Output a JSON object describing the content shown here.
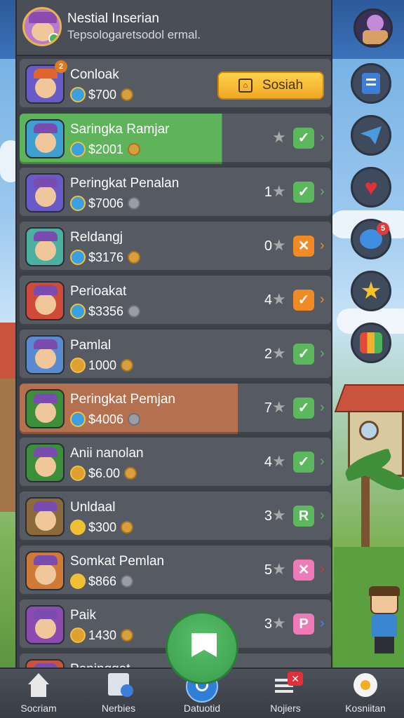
{
  "header": {
    "title": "Nestial Inserian",
    "subtitle": "Tepsologaretsodol ermal."
  },
  "featured": {
    "name": "Conloak",
    "value": "$700",
    "button_label": "Sosiah"
  },
  "rows": [
    {
      "name": "Saringka Ramjar",
      "value": "$2001",
      "rank": "",
      "action": "check",
      "badge": ""
    },
    {
      "name": "Peringkat Penalan",
      "value": "$7006",
      "rank": "1",
      "action": "check",
      "badge": ""
    },
    {
      "name": "Reldangj",
      "value": "$3176",
      "rank": "0",
      "action": "x",
      "badge": ""
    },
    {
      "name": "Perioakat",
      "value": "$3356",
      "rank": "4",
      "action": "check-orange",
      "badge": ""
    },
    {
      "name": "Pamlal",
      "value": "1000",
      "rank": "2",
      "action": "check",
      "badge": ""
    },
    {
      "name": "Peringkat Pemjan",
      "value": "$4006",
      "rank": "7",
      "action": "check",
      "badge": ""
    },
    {
      "name": "Anii nanolan",
      "value": "$6.00",
      "rank": "4",
      "action": "check",
      "badge": ""
    },
    {
      "name": "Unldaal",
      "value": "$300",
      "rank": "3",
      "action": "R",
      "badge": ""
    },
    {
      "name": "Somkat Pemlan",
      "value": "$866",
      "rank": "5",
      "action": "x-pink",
      "badge": ""
    },
    {
      "name": "Paik",
      "value": "1430",
      "rank": "3",
      "action": "P",
      "badge": ""
    },
    {
      "name": "Peninggat",
      "value": "",
      "rank": "",
      "action": "",
      "badge": ""
    }
  ],
  "badges": {
    "featured": "2",
    "row3": "5"
  },
  "side_buttons": [
    {
      "icon": "clipboard-icon"
    },
    {
      "icon": "paper-plane-icon"
    },
    {
      "icon": "heart-icon"
    },
    {
      "icon": "chat-bubble-icon",
      "count": "5"
    },
    {
      "icon": "star-icon"
    },
    {
      "icon": "gift-icon"
    }
  ],
  "nav": [
    {
      "label": "Socriam",
      "icon": "home-icon"
    },
    {
      "label": "Nerbies",
      "icon": "calendar-icon"
    },
    {
      "label": "Datuotid",
      "icon": "search-icon"
    },
    {
      "label": "Nojiers",
      "icon": "list-icon"
    },
    {
      "label": "Kosniitan",
      "icon": "flower-icon"
    }
  ],
  "colors": {
    "panel": "#3c4048",
    "row": "#555a63",
    "green_check": "#5cb85c",
    "orange": "#f08a24",
    "pink": "#f07ab8",
    "gold": "#f0a820"
  }
}
